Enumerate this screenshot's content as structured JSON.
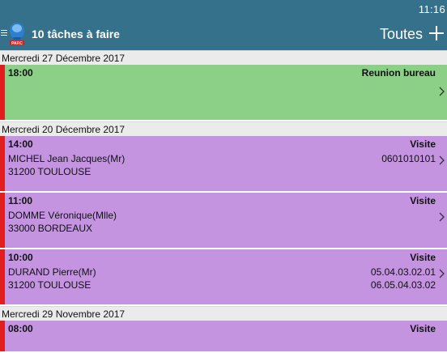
{
  "status_bar": {
    "time": "11:16"
  },
  "app_bar": {
    "title": "10 tâches à faire",
    "filter": "Toutes",
    "logo_text": "PARC",
    "logo_color": "#2d7fd3"
  },
  "colors": {
    "appbar": "#35718a",
    "meeting": "#8ccf87",
    "visit": "#c494e1",
    "priority": "#e01e1e"
  },
  "sections": [
    {
      "date": "Mercredi 27 Décembre 2017",
      "tasks": [
        {
          "time": "18:00",
          "kind": "Reunion bureau",
          "name": "",
          "city": "",
          "phone1": "",
          "phone2": ""
        }
      ]
    },
    {
      "date": "Mercredi 20 Décembre 2017",
      "tasks": [
        {
          "time": "14:00",
          "kind": "Visite",
          "name": "MICHEL Jean Jacques(Mr)",
          "city": "31200 TOULOUSE",
          "phone1": "0601010101",
          "phone2": ""
        },
        {
          "time": "11:00",
          "kind": "Visite",
          "name": "DOMME Véronique(Mlle)",
          "city": "33000 BORDEAUX",
          "phone1": "",
          "phone2": ""
        },
        {
          "time": "10:00",
          "kind": "Visite",
          "name": "DURAND Pierre(Mr)",
          "city": "31200 TOULOUSE",
          "phone1": "05.04.03.02.01",
          "phone2": "06.05.04.03.02"
        }
      ]
    },
    {
      "date": "Mercredi 29 Novembre 2017",
      "tasks": [
        {
          "time": "08:00",
          "kind": "Visite",
          "name": "",
          "city": "",
          "phone1": "",
          "phone2": ""
        }
      ]
    }
  ]
}
